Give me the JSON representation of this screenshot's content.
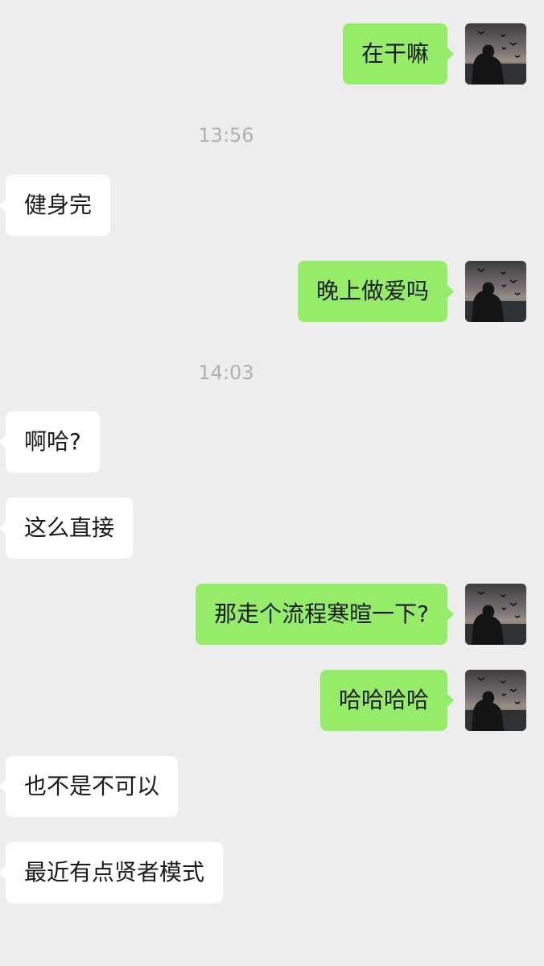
{
  "theme": {
    "background": "#ededed",
    "sent_bubble": "#95ec69",
    "received_bubble": "#ffffff",
    "timestamp_color": "#b0b0b0"
  },
  "messages": [
    {
      "sender": "me",
      "text": "在干嘛",
      "avatar_icon": "user-avatar-icon"
    },
    {
      "type": "timestamp",
      "text": "13:56"
    },
    {
      "sender": "other",
      "text": "健身完"
    },
    {
      "sender": "me",
      "text": "晚上做爱吗",
      "avatar_icon": "user-avatar-icon"
    },
    {
      "type": "timestamp",
      "text": "14:03"
    },
    {
      "sender": "other",
      "text": "啊哈?"
    },
    {
      "sender": "other",
      "text": "这么直接"
    },
    {
      "sender": "me",
      "text": "那走个流程寒暄一下?",
      "avatar_icon": "user-avatar-icon"
    },
    {
      "sender": "me",
      "text": "哈哈哈哈",
      "avatar_icon": "user-avatar-icon"
    },
    {
      "sender": "other",
      "text": "也不是不可以"
    },
    {
      "sender": "other",
      "text": "最近有点贤者模式"
    }
  ]
}
